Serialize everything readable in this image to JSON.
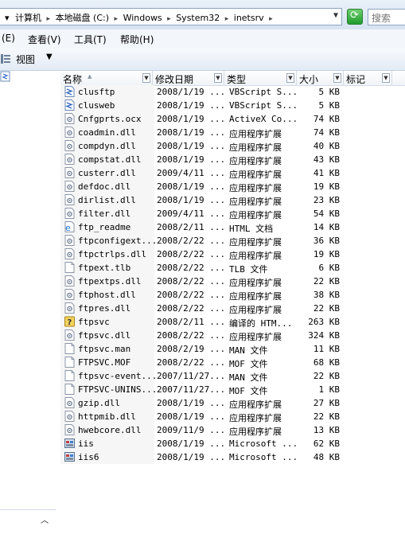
{
  "address": {
    "crumbs": [
      "计算机",
      "本地磁盘 (C:)",
      "Windows",
      "System32",
      "inetsrv"
    ],
    "prefix_arrow": "▾",
    "search_placeholder": "搜索"
  },
  "menu": [
    "(E)",
    "查看(V)",
    "工具(T)",
    "帮助(H)"
  ],
  "toolbar": {
    "view_label": "视图"
  },
  "columns": {
    "name": "名称",
    "date": "修改日期",
    "type": "类型",
    "size": "大小",
    "tag": "标记"
  },
  "files": [
    {
      "name": "clusftp",
      "date": "2008/1/19 ...",
      "type": "VBScript S...",
      "size": "5 KB",
      "icon": "vbscript-icon"
    },
    {
      "name": "clusweb",
      "date": "2008/1/19 ...",
      "type": "VBScript S...",
      "size": "5 KB",
      "icon": "vbscript-icon"
    },
    {
      "name": "Cnfgprts.ocx",
      "date": "2008/1/19 ...",
      "type": "ActiveX Co...",
      "size": "74 KB",
      "icon": "dll-icon"
    },
    {
      "name": "coadmin.dll",
      "date": "2008/1/19 ...",
      "type": "应用程序扩展",
      "size": "74 KB",
      "icon": "dll-icon"
    },
    {
      "name": "compdyn.dll",
      "date": "2008/1/19 ...",
      "type": "应用程序扩展",
      "size": "40 KB",
      "icon": "dll-icon"
    },
    {
      "name": "compstat.dll",
      "date": "2008/1/19 ...",
      "type": "应用程序扩展",
      "size": "43 KB",
      "icon": "dll-icon"
    },
    {
      "name": "custerr.dll",
      "date": "2009/4/11 ...",
      "type": "应用程序扩展",
      "size": "41 KB",
      "icon": "dll-icon"
    },
    {
      "name": "defdoc.dll",
      "date": "2008/1/19 ...",
      "type": "应用程序扩展",
      "size": "19 KB",
      "icon": "dll-icon"
    },
    {
      "name": "dirlist.dll",
      "date": "2008/1/19 ...",
      "type": "应用程序扩展",
      "size": "23 KB",
      "icon": "dll-icon"
    },
    {
      "name": "filter.dll",
      "date": "2009/4/11 ...",
      "type": "应用程序扩展",
      "size": "54 KB",
      "icon": "dll-icon"
    },
    {
      "name": "ftp_readme",
      "date": "2008/2/11 ...",
      "type": "HTML 文档",
      "size": "14 KB",
      "icon": "html-icon"
    },
    {
      "name": "ftpconfigext...",
      "date": "2008/2/22 ...",
      "type": "应用程序扩展",
      "size": "36 KB",
      "icon": "dll-icon"
    },
    {
      "name": "ftpctrlps.dll",
      "date": "2008/2/22 ...",
      "type": "应用程序扩展",
      "size": "19 KB",
      "icon": "dll-icon"
    },
    {
      "name": "ftpext.tlb",
      "date": "2008/2/22 ...",
      "type": "TLB 文件",
      "size": "6 KB",
      "icon": "file-icon"
    },
    {
      "name": "ftpextps.dll",
      "date": "2008/2/22 ...",
      "type": "应用程序扩展",
      "size": "22 KB",
      "icon": "dll-icon"
    },
    {
      "name": "ftphost.dll",
      "date": "2008/2/22 ...",
      "type": "应用程序扩展",
      "size": "38 KB",
      "icon": "dll-icon"
    },
    {
      "name": "ftpres.dll",
      "date": "2008/2/22 ...",
      "type": "应用程序扩展",
      "size": "22 KB",
      "icon": "dll-icon"
    },
    {
      "name": "ftpsvc",
      "date": "2008/2/11 ...",
      "type": "编译的 HTM...",
      "size": "263 KB",
      "icon": "chm-icon"
    },
    {
      "name": "ftpsvc.dll",
      "date": "2008/2/22 ...",
      "type": "应用程序扩展",
      "size": "324 KB",
      "icon": "dll-icon"
    },
    {
      "name": "ftpsvc.man",
      "date": "2008/2/19 ...",
      "type": "MAN 文件",
      "size": "11 KB",
      "icon": "file-icon"
    },
    {
      "name": "FTPSVC.MOF",
      "date": "2008/2/22 ...",
      "type": "MOF 文件",
      "size": "68 KB",
      "icon": "file-icon"
    },
    {
      "name": "ftpsvc-event...",
      "date": "2007/11/27...",
      "type": "MAN 文件",
      "size": "22 KB",
      "icon": "file-icon"
    },
    {
      "name": "FTPSVC-UNINS...",
      "date": "2007/11/27...",
      "type": "MOF 文件",
      "size": "1 KB",
      "icon": "file-icon"
    },
    {
      "name": "gzip.dll",
      "date": "2008/1/19 ...",
      "type": "应用程序扩展",
      "size": "27 KB",
      "icon": "dll-icon"
    },
    {
      "name": "httpmib.dll",
      "date": "2008/1/19 ...",
      "type": "应用程序扩展",
      "size": "22 KB",
      "icon": "dll-icon"
    },
    {
      "name": "hwebcore.dll",
      "date": "2009/11/9 ...",
      "type": "应用程序扩展",
      "size": "13 KB",
      "icon": "dll-icon"
    },
    {
      "name": "iis",
      "date": "2008/1/19 ...",
      "type": "Microsoft ...",
      "size": "62 KB",
      "icon": "msc-icon"
    },
    {
      "name": "iis6",
      "date": "2008/1/19 ...",
      "type": "Microsoft ...",
      "size": "48 KB",
      "icon": "msc-icon"
    }
  ]
}
